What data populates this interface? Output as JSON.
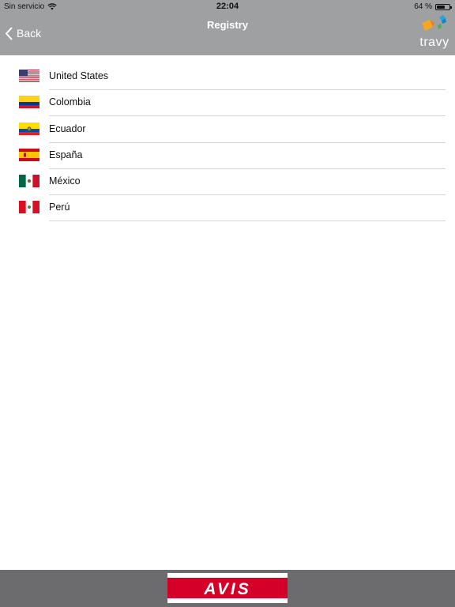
{
  "status_bar": {
    "carrier": "Sin servicio",
    "time": "22:04",
    "battery": "64 %",
    "battery_level": 0.64,
    "wifi_icon": "wifi-icon",
    "battery_icon": "battery-icon"
  },
  "nav": {
    "back_label": "Back",
    "title": "Registry",
    "logo_text": "travy"
  },
  "countries": [
    {
      "name": "United States",
      "flag": "flag-us-icon"
    },
    {
      "name": "Colombia",
      "flag": "flag-colombia-icon"
    },
    {
      "name": "Ecuador",
      "flag": "flag-ecuador-icon"
    },
    {
      "name": "España",
      "flag": "flag-spain-icon"
    },
    {
      "name": "México",
      "flag": "flag-mexico-icon"
    },
    {
      "name": "Perú",
      "flag": "flag-peru-icon"
    }
  ],
  "footer": {
    "brand": "AVIS"
  },
  "colors": {
    "header": "#9fa0a2",
    "footer": "#6c6c6e",
    "avis_red": "#d4002a"
  }
}
